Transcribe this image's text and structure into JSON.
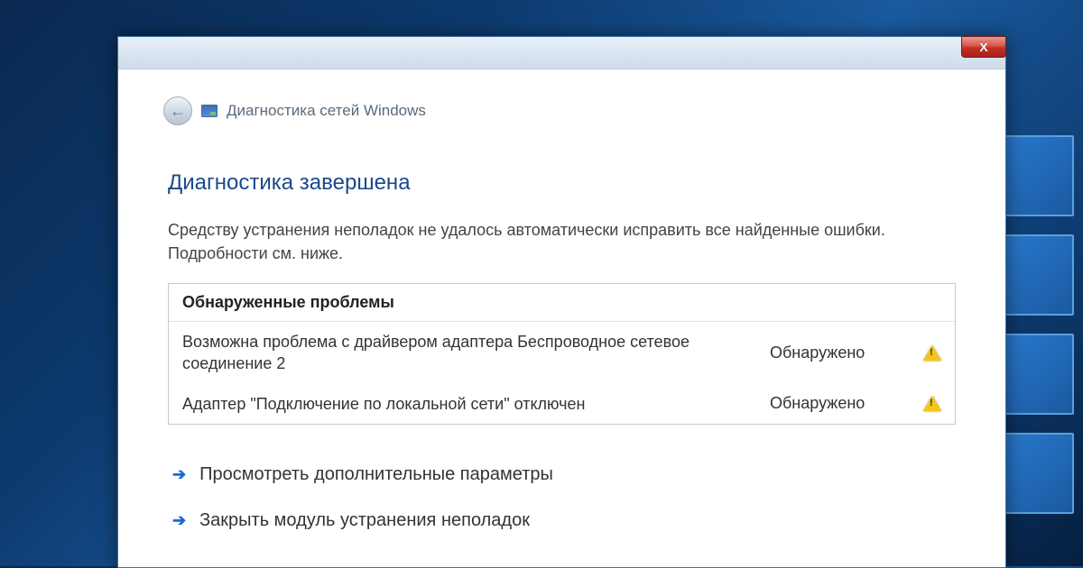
{
  "window": {
    "app_title": "Диагностика сетей Windows",
    "close_label": "X"
  },
  "content": {
    "heading": "Диагностика завершена",
    "subtext": "Средству устранения неполадок не удалось автоматически исправить все найденные ошибки. Подробности см. ниже.",
    "problems_header": "Обнаруженные проблемы",
    "problems": [
      {
        "desc": "Возможна проблема с драйвером адаптера Беспроводное сетевое соединение 2",
        "status": "Обнаружено"
      },
      {
        "desc": "Адаптер \"Подключение по локальной сети\" отключен",
        "status": "Обнаружено"
      }
    ],
    "actions": [
      {
        "label": "Просмотреть дополнительные параметры"
      },
      {
        "label": "Закрыть модуль устранения неполадок"
      }
    ]
  }
}
